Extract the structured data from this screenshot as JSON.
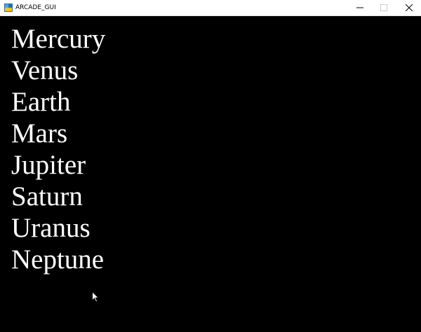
{
  "window": {
    "title": "ARCADE_GUI",
    "controls": {
      "minimize_icon": "minimize-icon",
      "maximize_icon": "maximize-icon",
      "close_icon": "close-icon"
    },
    "app_icon": "app-icon"
  },
  "canvas": {
    "background": "#000000",
    "text_color": "#ffffff",
    "planets": [
      "Mercury",
      "Venus",
      "Earth",
      "Mars",
      "Jupiter",
      "Saturn",
      "Uranus",
      "Neptune"
    ]
  },
  "pointer": {
    "icon": "mouse-pointer-icon"
  }
}
